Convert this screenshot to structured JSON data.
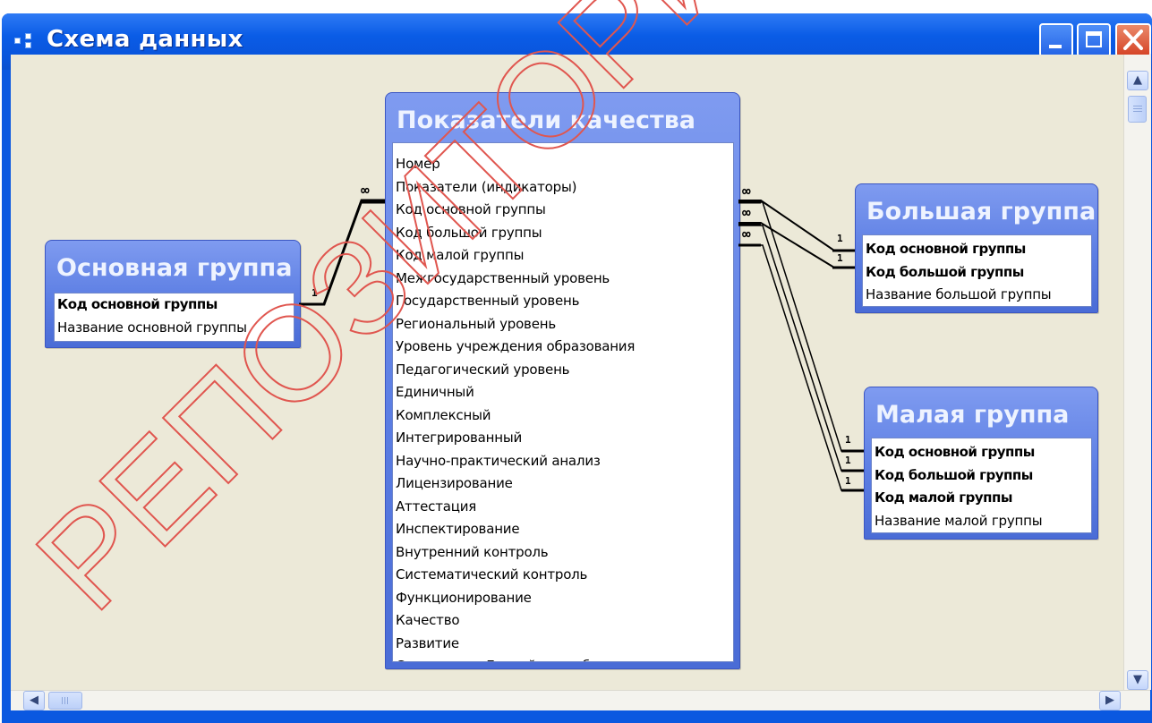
{
  "window": {
    "title": "Схема данных"
  },
  "tables": {
    "main_group": {
      "title": "Основная группа",
      "fields": [
        "Код основной группы",
        "Название основной группы"
      ],
      "pk_count": 1
    },
    "quality": {
      "title": "Показатели качества",
      "fields": [
        "Номер",
        "Показатели (индикаторы)",
        "Код основной группы",
        "Код большой группы",
        "Код малой группы",
        "Межгосударственный уровень",
        "Государственный уровень",
        "Региональный уровень",
        "Уровень учреждения образования",
        "Педагогический уровень",
        "Единичный",
        "Комплексный",
        "Интегрированный",
        "Научно-практический анализ",
        "Лицензирование",
        "Аттестация",
        "Инспектирование",
        "Внутренний контроль",
        "Систематический контроль",
        "Функционирование",
        "Качество",
        "Развитие",
        "Сравнение с Еропейским образованием"
      ],
      "pk_count": 0
    },
    "big_group": {
      "title": "Большая группа",
      "fields": [
        "Код основной группы",
        "Код большой группы",
        "Название большой группы"
      ],
      "pk_count": 2
    },
    "small_group": {
      "title": "Малая группа",
      "fields": [
        "Код основной группы",
        "Код большой группы",
        "Код малой группы",
        "Название малой группы"
      ],
      "pk_count": 3
    }
  },
  "relationship_labels": {
    "one": "1",
    "many": "∞"
  },
  "watermark": {
    "text": "РЕПОЗИТОРИЙ",
    "color": "#e0564f"
  },
  "colors": {
    "title_bar": "#0a58e0",
    "table_header": "#5c7ee3",
    "canvas": "#ece9d8",
    "close_button": "#d54326"
  },
  "icons": {
    "scroll_up": "▲",
    "scroll_down": "▼",
    "scroll_left": "◀",
    "scroll_right": "▶"
  }
}
